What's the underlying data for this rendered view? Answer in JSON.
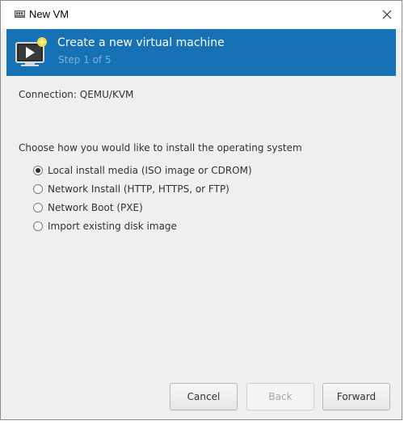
{
  "window": {
    "title": "New VM",
    "close_glyph": "×"
  },
  "banner": {
    "title": "Create a new virtual machine",
    "step": "Step 1 of 5",
    "icon": "vm-display-icon",
    "color": "#1772b5"
  },
  "connection": {
    "text": "Connection:  QEMU/KVM"
  },
  "install": {
    "prompt": "Choose how you would like to install the operating system",
    "options": [
      {
        "label": "Local install media (ISO image or CDROM)",
        "selected": true
      },
      {
        "label": "Network Install (HTTP, HTTPS, or FTP)",
        "selected": false
      },
      {
        "label": "Network Boot (PXE)",
        "selected": false
      },
      {
        "label": "Import existing disk image",
        "selected": false
      }
    ]
  },
  "buttons": {
    "cancel": "Cancel",
    "back": "Back",
    "forward": "Forward"
  }
}
